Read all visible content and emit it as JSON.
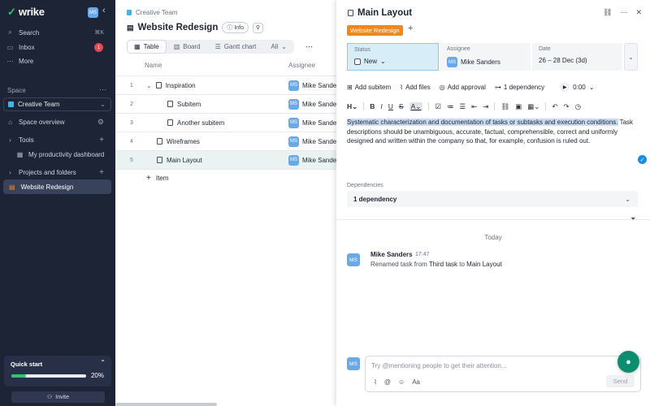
{
  "sidebar": {
    "logo_text": "wrike",
    "user_initials": "MS",
    "search_label": "Search",
    "search_shortcut": "⌘K",
    "inbox_label": "Inbox",
    "inbox_count": "1",
    "more_label": "More",
    "space_section": "Space",
    "space_name": "Creative Team",
    "space_overview": "Space overview",
    "tools_section": "Tools",
    "dashboard_label": "My productivity dashboard",
    "projects_section": "Projects and folders",
    "active_project": "Website Redesign",
    "quick_start_label": "Quick start",
    "quick_start_pct": "20%",
    "quick_start_progress": 0.2,
    "invite_label": "Invite"
  },
  "project": {
    "breadcrumb": "Creative Team",
    "title": "Website Redesign",
    "info_label": "Info",
    "views": [
      {
        "label": "Table"
      },
      {
        "label": "Board"
      },
      {
        "label": "Gantt chart"
      },
      {
        "label": "All"
      }
    ],
    "columns": {
      "name": "Name",
      "assignee": "Assignee"
    },
    "rows": [
      {
        "num": "1",
        "name": "Inspiration",
        "assignee": "Mike Sanders",
        "initials": "MS"
      },
      {
        "num": "2",
        "name": "Subitem",
        "assignee": "Mike Sanders",
        "initials": "MS"
      },
      {
        "num": "3",
        "name": "Another subitem",
        "assignee": "Mike Sanders",
        "initials": "MS"
      },
      {
        "num": "4",
        "name": "Wireframes",
        "assignee": "Mike Sanders",
        "initials": "MS"
      },
      {
        "num": "5",
        "name": "Main Layout",
        "assignee": "Mike Sanders",
        "initials": "MS"
      }
    ],
    "add_item_label": "Item"
  },
  "task": {
    "title": "Main Layout",
    "tag": "Website Redesign",
    "status_label": "Status",
    "status_value": "New",
    "assignee_label": "Assignee",
    "assignee_value": "Mike Sanders",
    "assignee_initials": "MS",
    "date_label": "Date",
    "date_value": "26 – 28 Dec (3d)",
    "actions": {
      "add_subitem": "Add subitem",
      "add_files": "Add files",
      "add_approval": "Add approval",
      "dependency": "1 dependency",
      "timer": "0:00"
    },
    "description_highlight": "Systematic characterization and documentation of tasks or subtasks and execution conditions.",
    "description_rest": " Task descriptions should be unambiguous, accurate, factual, comprehensible, correct and uniformly designed and written within the company so that, for example, confusion is ruled out.",
    "dependencies_label": "Dependencies",
    "dependencies_value": "1 dependency"
  },
  "activity": {
    "day_label": "Today",
    "author": "Mike Sanders",
    "author_initials": "MS",
    "time": "17:47",
    "text_prefix": "Renamed task from",
    "old_name": "Third task",
    "text_mid": "to",
    "new_name": "Main Layout"
  },
  "comment": {
    "user_initials": "MS",
    "placeholder": "Try @mentioning people to get their attention...",
    "send_label": "Send"
  },
  "colors": {
    "sidebar_bg": "#1c2436",
    "accent_green": "#34c36b",
    "tag_orange": "#ef8a1a",
    "status_blue": "#d7eef8",
    "chat_teal": "#0d8d6f"
  }
}
